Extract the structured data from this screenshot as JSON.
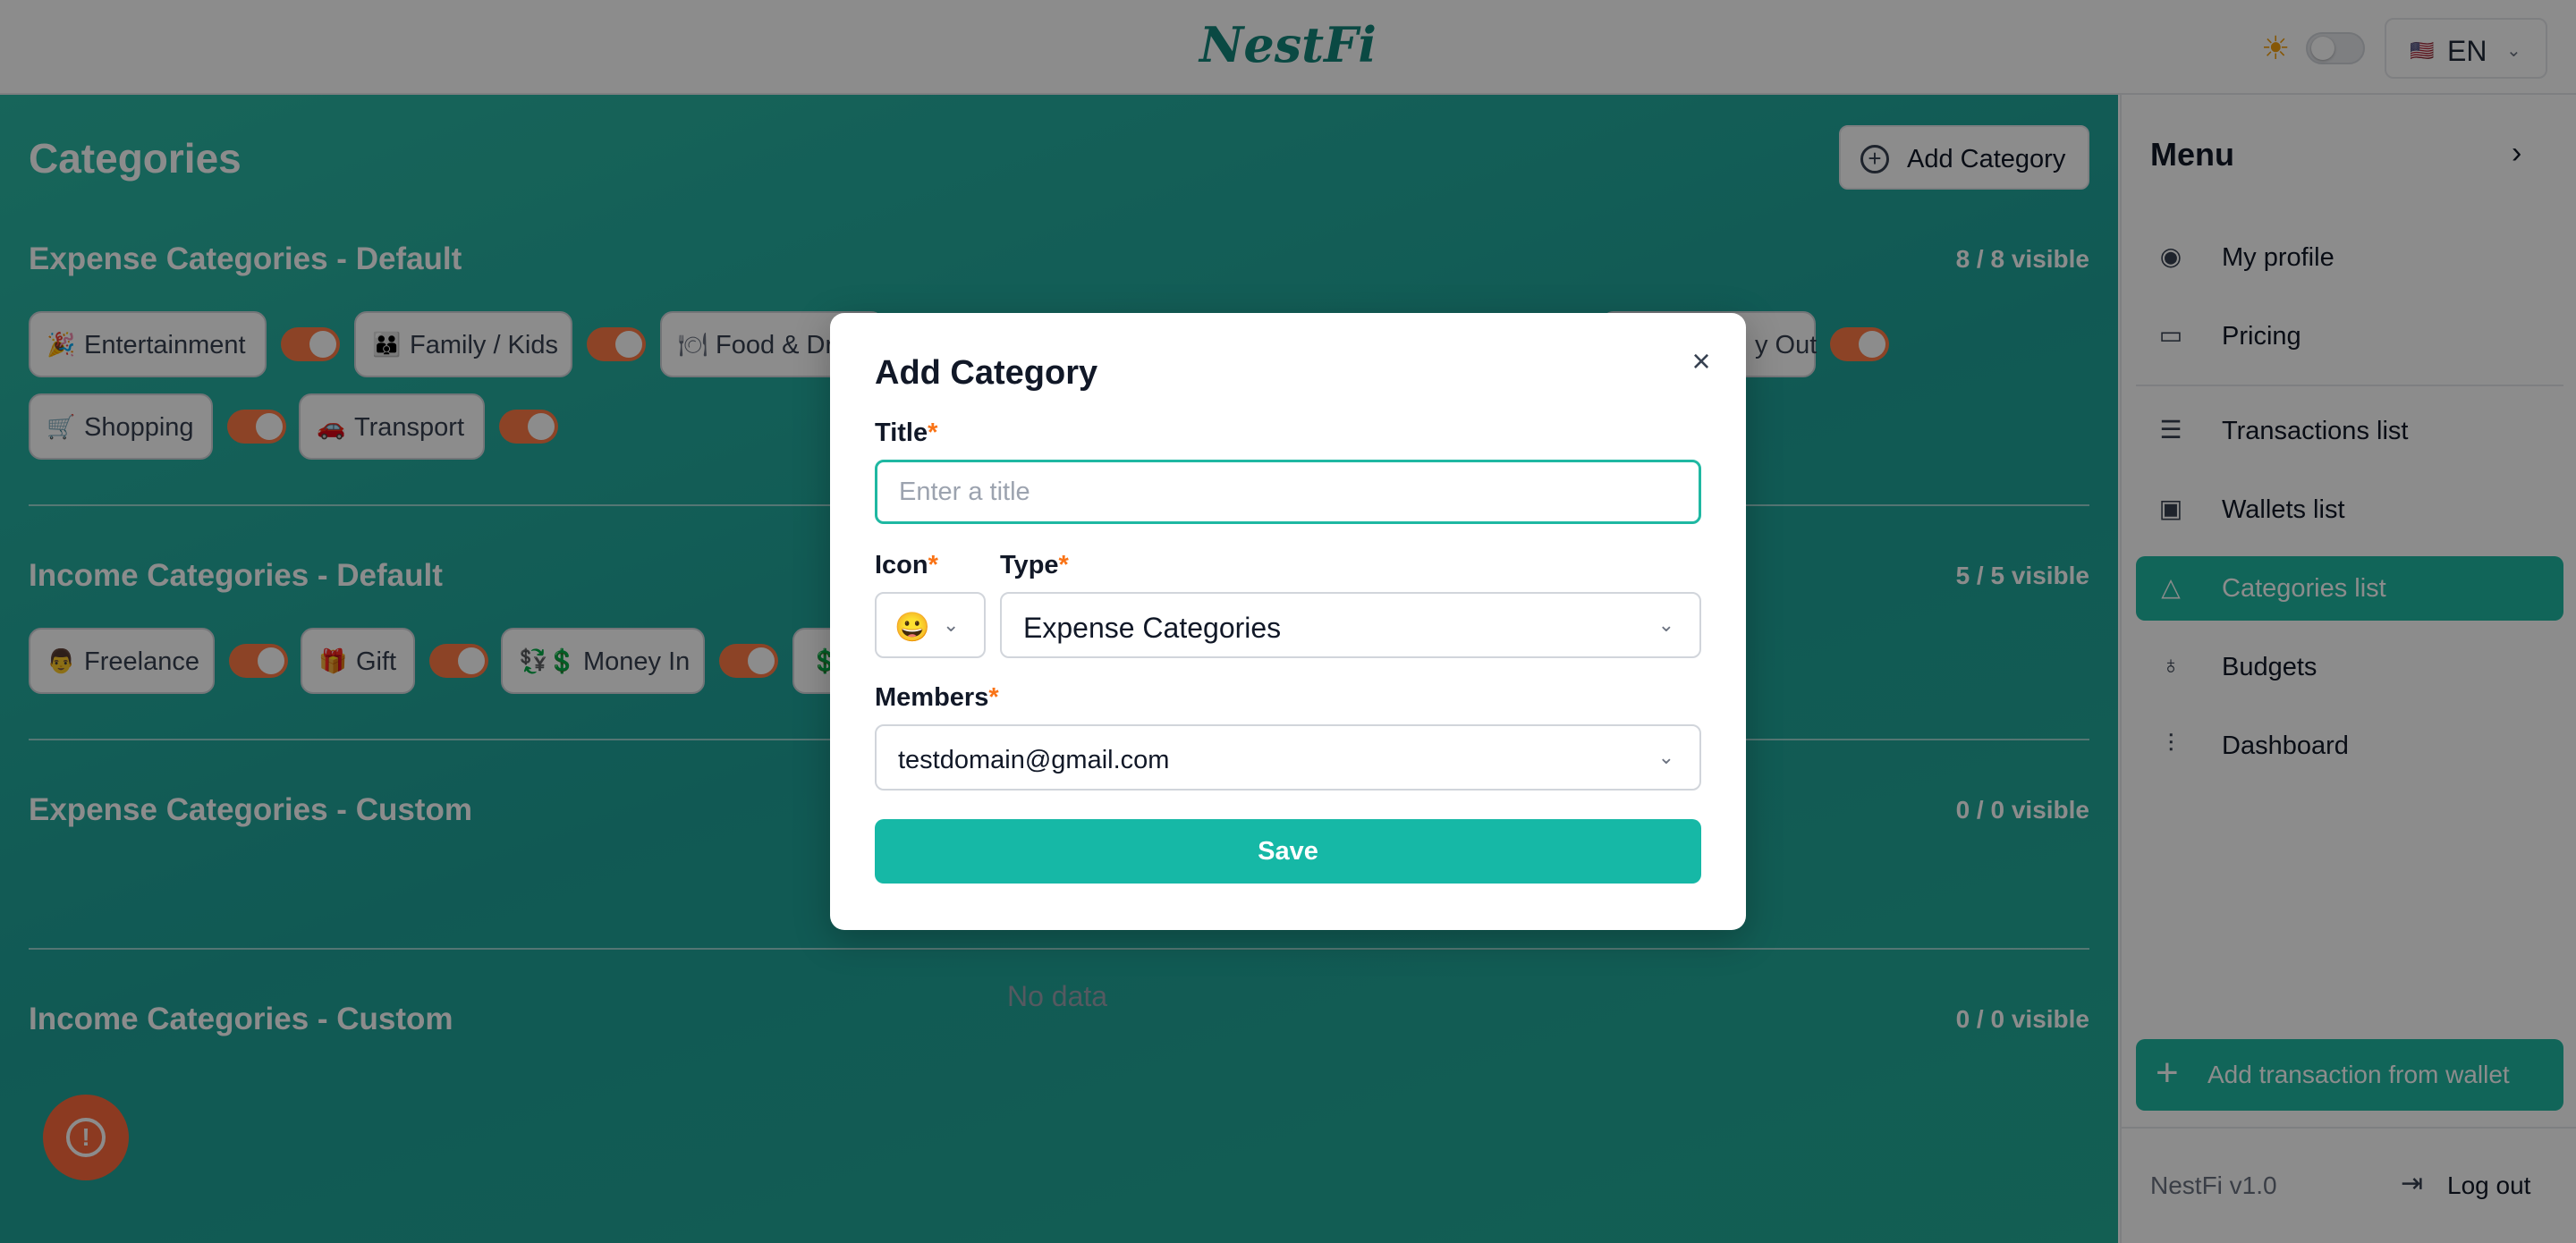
{
  "header": {
    "logo": "NestFi",
    "lang_flag": "🇺🇸",
    "lang_code": "EN"
  },
  "page": {
    "title": "Categories",
    "add_category_label": "Add Category",
    "no_data": "No data"
  },
  "sections": {
    "expense_default": {
      "title": "Expense Categories - Default",
      "count": "8 / 8 visible",
      "chips": [
        {
          "icon": "🎉",
          "label": "Entertainment"
        },
        {
          "icon": "👪",
          "label": "Family / Kids"
        },
        {
          "icon": "🍽",
          "label": "Food & Dr"
        },
        {
          "label": "y Out"
        },
        {
          "icon": "🛒",
          "label": "Shopping"
        },
        {
          "icon": "🚗",
          "label": "Transport"
        }
      ]
    },
    "income_default": {
      "title": "Income Categories - Default",
      "count": "5 / 5 visible",
      "chips": [
        {
          "icon": "👨",
          "label": "Freelance"
        },
        {
          "icon": "🎁",
          "label": "Gift"
        },
        {
          "icon": "💱💲",
          "label": "Money In"
        },
        {
          "icon": "💲"
        }
      ]
    },
    "expense_custom": {
      "title": "Expense Categories - Custom",
      "count": "0 / 0 visible"
    },
    "income_custom": {
      "title": "Income Categories - Custom",
      "count": "0 / 0 visible"
    }
  },
  "menu": {
    "title": "Menu",
    "items": [
      {
        "icon": "user-circle-icon",
        "label": "My profile"
      },
      {
        "icon": "credit-card-icon",
        "label": "Pricing"
      },
      {
        "icon": "list-icon",
        "label": "Transactions list"
      },
      {
        "icon": "wallet-icon",
        "label": "Wallets list"
      },
      {
        "icon": "shapes-icon",
        "label": "Categories list"
      },
      {
        "icon": "piggy-bank-icon",
        "label": "Budgets"
      },
      {
        "icon": "chart-icon",
        "label": "Dashboard"
      }
    ],
    "add_transaction_label": "Add transaction from wallet",
    "version": "NestFi v1.0",
    "logout_label": "Log out"
  },
  "modal": {
    "title": "Add Category",
    "title_label": "Title",
    "title_placeholder": "Enter a title",
    "title_value": "",
    "icon_label": "Icon",
    "icon_value": "😀",
    "type_label": "Type",
    "type_value": "Expense Categories",
    "members_label": "Members",
    "members_value": "testdomain@gmail.com",
    "required_mark": "*",
    "save_label": "Save"
  },
  "colors": {
    "brand": "#13857a",
    "accent": "#1fb8a2",
    "switch_on": "#ff7a45",
    "required": "#f97316"
  }
}
